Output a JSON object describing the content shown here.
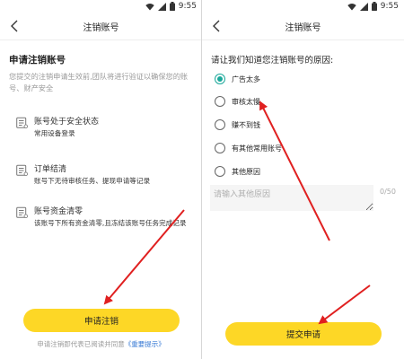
{
  "status_bar": {
    "time": "9:55"
  },
  "left": {
    "nav_title": "注销账号",
    "heading": "申请注销账号",
    "description": "您提交的注销申请生效前,团队将进行验证以确保您的账号、财产安全",
    "checks": [
      {
        "title": "账号处于安全状态",
        "desc": "常用设备登录"
      },
      {
        "title": "订单结清",
        "desc": "账号下无待审核任务、提现申请等记录"
      },
      {
        "title": "账号资金清零",
        "desc": "该账号下所有资金清零,且冻结该账号任务完成记录"
      }
    ],
    "button_label": "申请注销",
    "footer_prefix": "申请注销即代表已阅读并同意",
    "footer_link": "《重要提示》"
  },
  "right": {
    "nav_title": "注销账号",
    "question": "请让我们知道您注销账号的原因:",
    "reasons": [
      {
        "label": "广告太多",
        "selected": true
      },
      {
        "label": "审核太慢",
        "selected": false
      },
      {
        "label": "赚不到钱",
        "selected": false
      },
      {
        "label": "有其他常用账号",
        "selected": false
      },
      {
        "label": "其他原因",
        "selected": false
      }
    ],
    "input_placeholder": "请输入其他原因",
    "input_counter": "0/50",
    "submit_label": "提交申请"
  },
  "colors": {
    "accent_yellow": "#fdd726",
    "radio_teal": "#1aa89a",
    "arrow_red": "#e02020",
    "link_blue": "#3a7bd5"
  },
  "icons": [
    "back-arrow-icon",
    "wifi-icon",
    "signal-icon",
    "battery-icon",
    "checklist-icon",
    "radio-button-icon"
  ]
}
